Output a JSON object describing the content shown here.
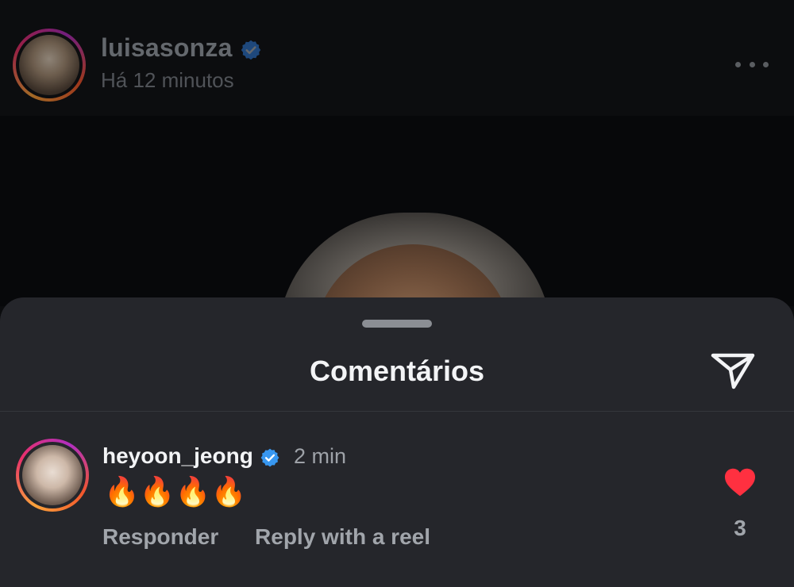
{
  "post": {
    "username": "luisasonza",
    "timestamp": "Há 12 minutos"
  },
  "sheet": {
    "title": "Comentários"
  },
  "comment": {
    "username": "heyoon_jeong",
    "time": "2 min",
    "text": "🔥🔥🔥🔥",
    "reply_label": "Responder",
    "reel_label": "Reply with a reel",
    "like_count": "3"
  },
  "colors": {
    "verified_badge": "#3897f0",
    "like_heart": "#ff3040",
    "sheet_background": "#25262b"
  },
  "icons": [
    "verified-badge-icon",
    "more-options-icon",
    "send-icon",
    "heart-icon"
  ]
}
